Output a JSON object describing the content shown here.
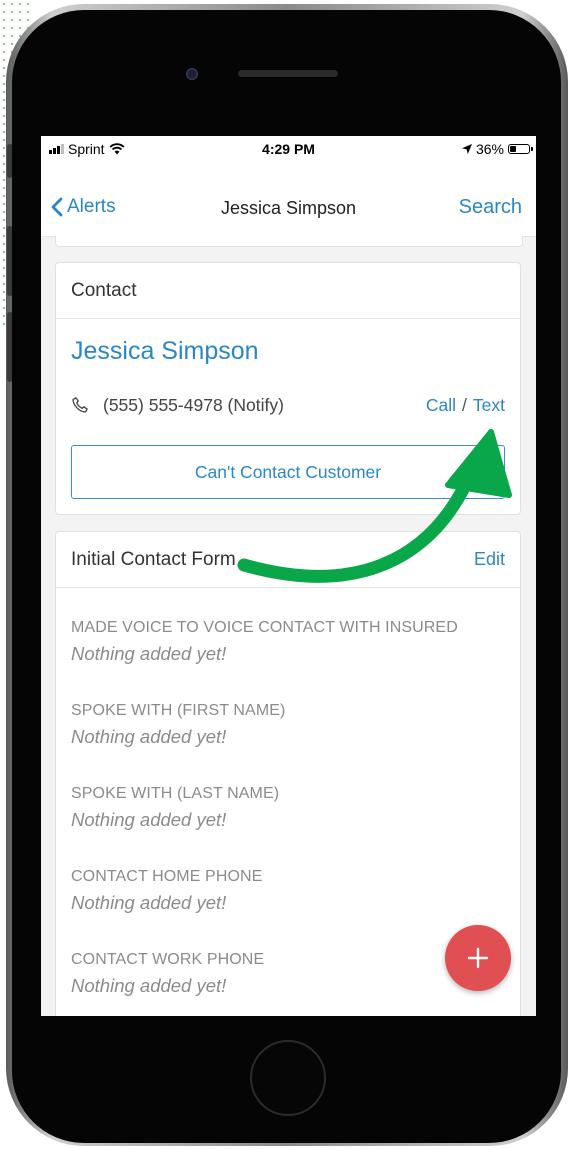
{
  "status_bar": {
    "carrier": "Sprint",
    "time": "4:29 PM",
    "battery": "36%",
    "battery_level": 0.36
  },
  "nav": {
    "back_label": "Alerts",
    "title": "Jessica Simpson",
    "search_label": "Search"
  },
  "contact_card": {
    "header": "Contact",
    "name": "Jessica Simpson",
    "phone": "(555) 555-4978 (Notify)",
    "call_label": "Call",
    "separator": "/",
    "text_label": "Text",
    "cant_contact_label": "Can't Contact Customer"
  },
  "form_card": {
    "header": "Initial Contact Form",
    "edit_label": "Edit",
    "fields": [
      {
        "label": "MADE VOICE TO VOICE CONTACT WITH INSURED",
        "value": "Nothing added yet!"
      },
      {
        "label": "SPOKE WITH (FIRST NAME)",
        "value": "Nothing added yet!"
      },
      {
        "label": "SPOKE WITH (LAST NAME)",
        "value": "Nothing added yet!"
      },
      {
        "label": "CONTACT HOME PHONE",
        "value": "Nothing added yet!"
      },
      {
        "label": "CONTACT WORK PHONE",
        "value": "Nothing added yet!"
      }
    ]
  },
  "fab": {
    "icon": "plus-icon",
    "color": "#e04f52"
  },
  "colors": {
    "accent": "#2a87c6",
    "arrow": "#0aa64a"
  }
}
